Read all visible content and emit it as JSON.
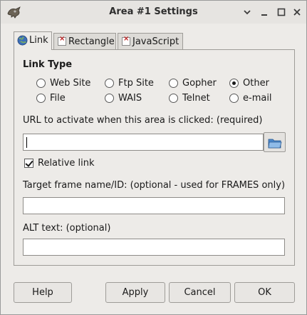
{
  "window": {
    "title": "Area #1 Settings"
  },
  "tabs": [
    {
      "label": "Link",
      "mnemonic_index": 0
    },
    {
      "label": "Rectangle",
      "mnemonic_index": 0
    },
    {
      "label": "JavaScript",
      "mnemonic_index": 0
    }
  ],
  "link_type": {
    "title": "Link Type",
    "options": [
      {
        "label": "Web Site",
        "selected": false
      },
      {
        "label": "Ftp Site",
        "selected": false
      },
      {
        "label": "Gopher",
        "selected": false
      },
      {
        "label": "Other",
        "selected": true
      },
      {
        "label": "File",
        "selected": false
      },
      {
        "label": "WAIS",
        "selected": false
      },
      {
        "label": "Telnet",
        "selected": false
      },
      {
        "label": "e-mail",
        "selected": false
      }
    ]
  },
  "url": {
    "label": "URL to activate when this area is clicked: (required)",
    "value": ""
  },
  "relative_link": {
    "label": "Relative link",
    "checked": true
  },
  "target": {
    "label": "Target frame name/ID: (optional - used for FRAMES only)",
    "value": ""
  },
  "alt": {
    "label": "ALT text: (optional)",
    "value": ""
  },
  "buttons": {
    "help": "Help",
    "apply": "Apply",
    "cancel": "Cancel",
    "ok": "OK"
  }
}
